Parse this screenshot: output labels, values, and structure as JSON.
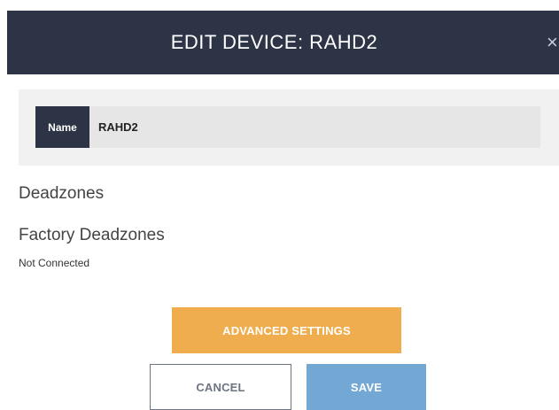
{
  "modal": {
    "title": "EDIT DEVICE: RAHD2",
    "close_glyph": "×",
    "close_icon": "close-icon"
  },
  "name_field": {
    "label": "Name",
    "value": "RAHD2"
  },
  "sections": {
    "deadzones": "Deadzones",
    "factory_deadzones": "Factory Deadzones",
    "status": "Not Connected"
  },
  "buttons": {
    "advanced_settings": "ADVANCED SETTINGS",
    "cancel": "CANCEL",
    "save": "SAVE"
  },
  "colors": {
    "header_bg": "#2d3446",
    "advanced_button": "#f0ad4e",
    "save_button": "#73a8d4",
    "cancel_border": "#6d7482"
  }
}
